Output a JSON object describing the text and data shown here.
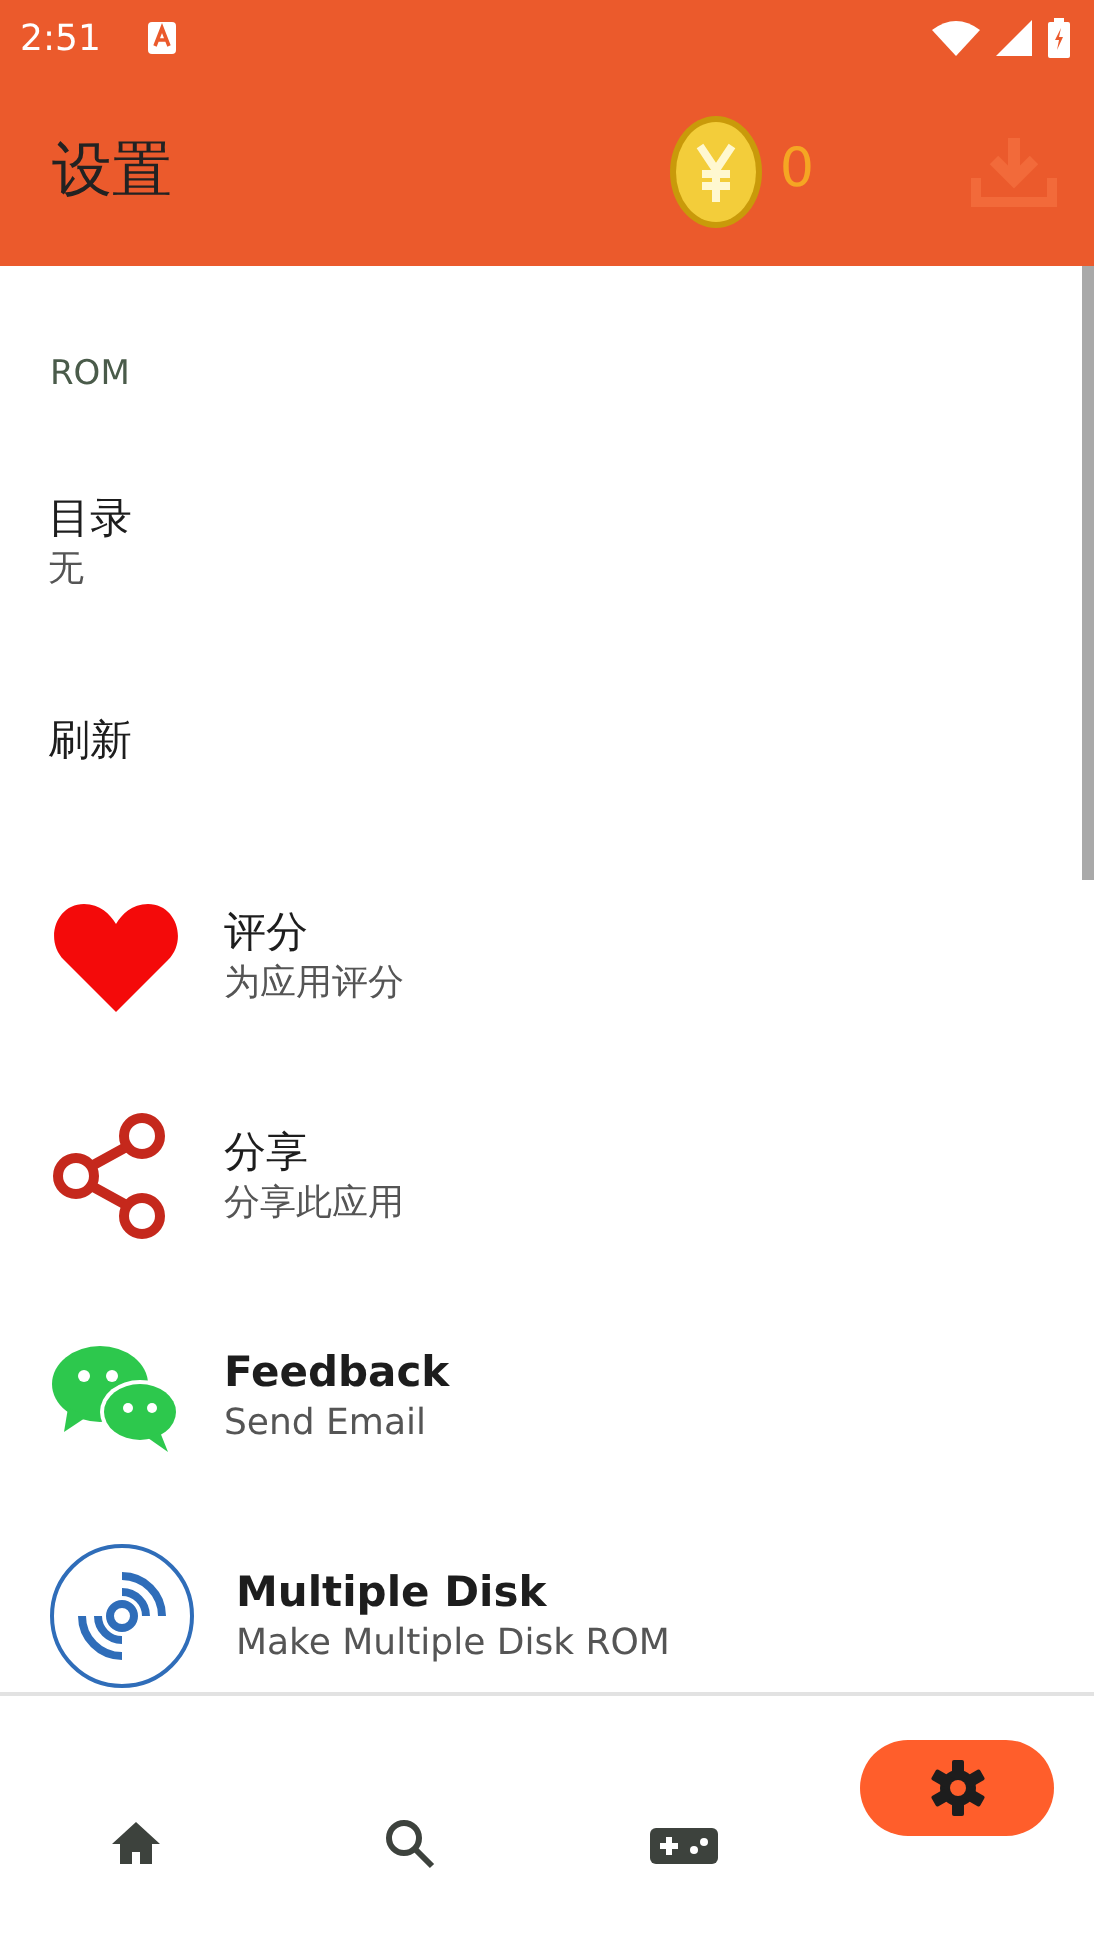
{
  "status_bar": {
    "time": "2:51"
  },
  "app_bar": {
    "title": "设置",
    "coins": "0"
  },
  "section": {
    "title": "ROM"
  },
  "items": [
    {
      "kind": "text",
      "title": "目录",
      "subtitle": "无"
    },
    {
      "kind": "text",
      "title": "刷新"
    },
    {
      "kind": "heart",
      "title": "评分",
      "subtitle": "为应用评分"
    },
    {
      "kind": "share",
      "title": "分享",
      "subtitle": "分享此应用"
    },
    {
      "kind": "chat",
      "title": "Feedback",
      "subtitle": "Send Email"
    },
    {
      "kind": "disc",
      "title": "Multiple Disk",
      "subtitle": "Make Multiple Disk ROM"
    }
  ],
  "bottom_nav": [
    {
      "kind": "home",
      "selected": false
    },
    {
      "kind": "search",
      "selected": false
    },
    {
      "kind": "gamepad",
      "selected": false
    },
    {
      "kind": "settings",
      "selected": true
    }
  ]
}
